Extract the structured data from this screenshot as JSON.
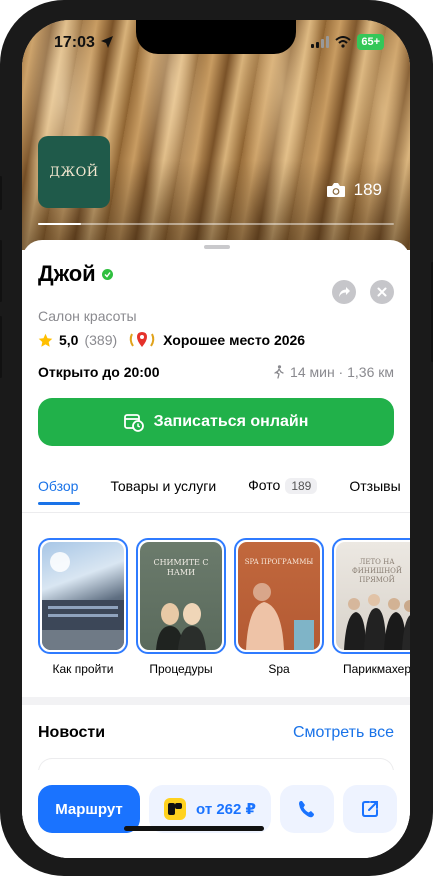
{
  "status_bar": {
    "time": "17:03",
    "battery": "65+"
  },
  "hero": {
    "logo_text": "ДЖОЙ",
    "photo_count": "189",
    "gallery_progress": 0.12
  },
  "place": {
    "name": "Джой",
    "category": "Салон красоты",
    "rating": "5,0",
    "reviews_count": "(389)",
    "award": "Хорошее место 2026",
    "hours": "Открыто до 20:00",
    "distance": "14 мин · 1,36 км"
  },
  "cta": {
    "label": "Записаться онлайн"
  },
  "tabs": [
    {
      "label": "Обзор",
      "active": true
    },
    {
      "label": "Товары и услуги"
    },
    {
      "label": "Фото",
      "badge": "189"
    },
    {
      "label": "Отзывы"
    }
  ],
  "stories": [
    {
      "label": "Как пройти"
    },
    {
      "label": "Процедуры",
      "image_text": "СНИМИТЕ С НАМИ"
    },
    {
      "label": "Spa",
      "image_text": "SPA ПРОГРАММЫ"
    },
    {
      "label": "Парикмахер",
      "image_text": "ЛЕТО НА ФИНИШНОЙ ПРЯМОЙ"
    }
  ],
  "news": {
    "title": "Новости",
    "see_all": "Смотреть все"
  },
  "bottom_actions": {
    "route": "Маршрут",
    "taxi": "от 262 ₽"
  },
  "colors": {
    "accent_green": "#21b14a",
    "accent_blue": "#1a73ff",
    "link_blue": "#1a73e8"
  },
  "icons": [
    "location-arrow-icon",
    "signal-icon",
    "wifi-icon",
    "camera-icon",
    "verified-icon",
    "share-icon",
    "close-icon",
    "star-icon",
    "award-icon",
    "walk-icon",
    "calendar-clock-icon",
    "taxi-icon",
    "phone-icon",
    "external-link-icon"
  ]
}
